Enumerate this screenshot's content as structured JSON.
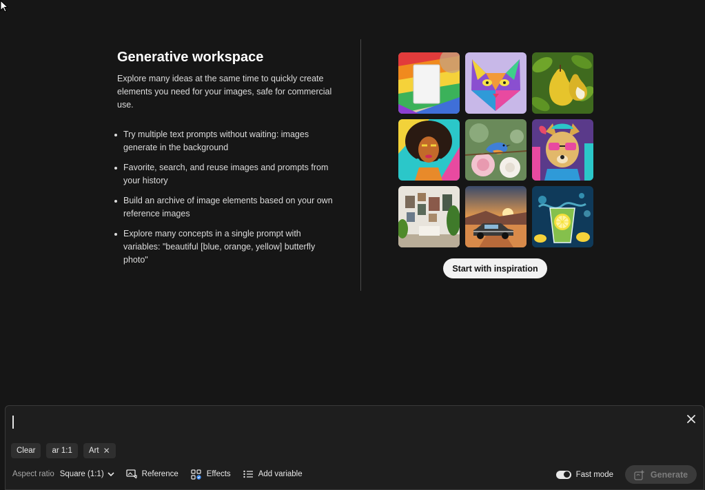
{
  "intro": {
    "title": "Generative workspace",
    "subtitle": "Explore many ideas at the same time to quickly create elements you need for your images, safe for commercial use.",
    "bullets": [
      "Try multiple text prompts without waiting: images generate in the background",
      "Favorite, search, and reuse images and prompts from your history",
      "Build an archive of image elements based on your own reference images",
      "Explore many concepts in a single prompt with variables: \"beautiful [blue, orange, yellow] butterfly photo\""
    ]
  },
  "inspiration": {
    "thumbnails": [
      {
        "icon": "fabric-swatches-image"
      },
      {
        "icon": "geometric-cat-image"
      },
      {
        "icon": "pears-image"
      },
      {
        "icon": "portrait-woman-image"
      },
      {
        "icon": "bird-roses-image"
      },
      {
        "icon": "dog-sunglasses-image"
      },
      {
        "icon": "gallery-room-image"
      },
      {
        "icon": "vintage-car-sunset-image"
      },
      {
        "icon": "lemonade-splash-image"
      }
    ],
    "button_label": "Start with inspiration"
  },
  "prompt_panel": {
    "prompt_value": "",
    "chips": {
      "clear": "Clear",
      "aspect": "ar 1:1",
      "art": "Art",
      "art_remove": "✕"
    },
    "toolbar": {
      "aspect_label": "Aspect ratio",
      "aspect_value": "Square (1:1)",
      "reference": "Reference",
      "effects": "Effects",
      "add_variable": "Add variable"
    },
    "fast_mode": {
      "label": "Fast mode",
      "enabled": true
    },
    "generate_label": "Generate"
  },
  "colors": {
    "background": "#161616",
    "panel": "#1e1e1e",
    "accent_button": "#f2f2f2",
    "generate_disabled": "#3a3a3a"
  }
}
